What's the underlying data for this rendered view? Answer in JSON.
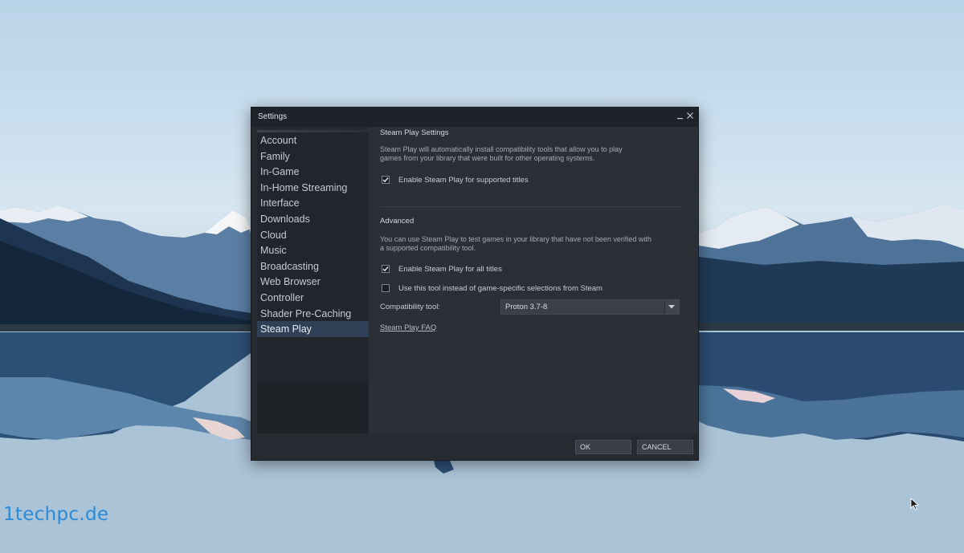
{
  "window": {
    "title": "Settings"
  },
  "sidebar": {
    "items": [
      {
        "label": "Account"
      },
      {
        "label": "Family"
      },
      {
        "label": "In-Game"
      },
      {
        "label": "In-Home Streaming"
      },
      {
        "label": "Interface"
      },
      {
        "label": "Downloads"
      },
      {
        "label": "Cloud"
      },
      {
        "label": "Music"
      },
      {
        "label": "Broadcasting"
      },
      {
        "label": "Web Browser"
      },
      {
        "label": "Controller"
      },
      {
        "label": "Shader Pre-Caching"
      },
      {
        "label": "Steam Play",
        "active": true
      }
    ]
  },
  "steam_play": {
    "heading": "Steam Play Settings",
    "description_line1": "Steam Play will automatically install compatibility tools that allow you to play",
    "description_line2": "games from your library that were built for other operating systems.",
    "enable_supported": {
      "label": "Enable Steam Play for supported titles",
      "checked": true
    }
  },
  "advanced": {
    "heading": "Advanced",
    "description_line1": "You can use Steam Play to test games in your library that have not been verified with",
    "description_line2": "a supported compatibility tool.",
    "enable_all": {
      "label": "Enable Steam Play for all titles",
      "checked": true
    },
    "use_tool": {
      "label": "Use this tool instead of game-specific selections from Steam",
      "checked": false
    },
    "compat_tool_label": "Compatibility tool:",
    "compat_tool_value": "Proton 3.7-8",
    "faq_link": "Steam Play FAQ"
  },
  "footer": {
    "ok_label": "OK",
    "cancel_label": "CANCEL"
  },
  "watermark": "1techpc.de",
  "colors": {
    "active_item": "#2f3f55",
    "window_bg": "#262a31",
    "watermark": "#2a8ad8"
  }
}
